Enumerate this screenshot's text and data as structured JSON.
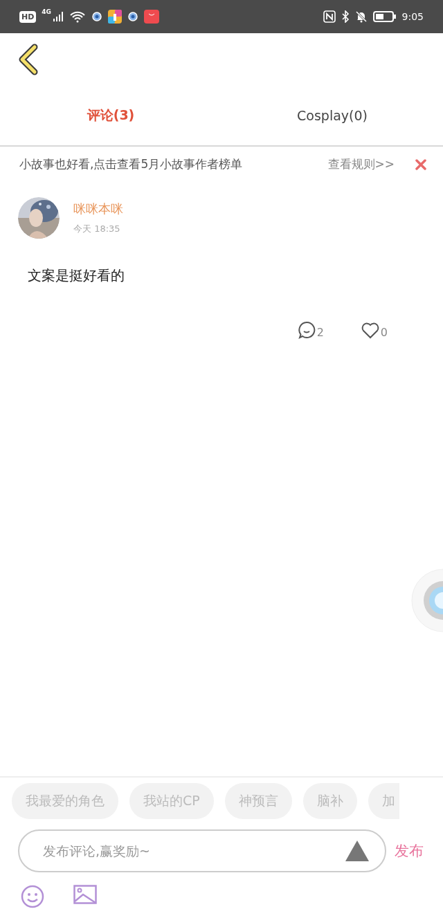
{
  "status_bar": {
    "badge": "HD",
    "network": "4G",
    "time": "9:05"
  },
  "tabs": [
    {
      "label": "评论(3)",
      "selected": true
    },
    {
      "label": "Cosplay(0)",
      "selected": false
    }
  ],
  "notice": {
    "text": "小故事也好看,点击查看5月小故事作者榜单",
    "link": "查看规则>>"
  },
  "comments": [
    {
      "author": "咪咪本咪",
      "time": "今天 18:35",
      "text": "文案是挺好看的",
      "replies": "2",
      "likes": "0",
      "liked": false
    }
  ],
  "composer": {
    "chips": [
      "我最爱的角色",
      "我站的CP",
      "神预言",
      "脑补",
      "加"
    ],
    "placeholder": "发布评论,赢奖励~",
    "submit": "发布"
  }
}
